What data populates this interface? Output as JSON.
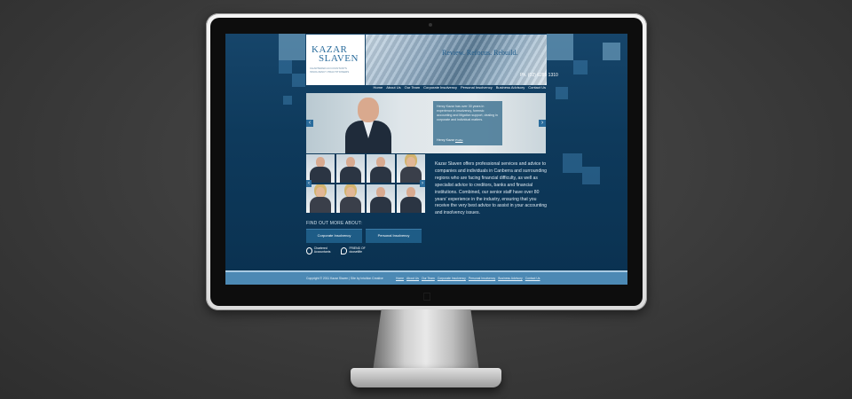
{
  "site": {
    "logo": {
      "line1": "KAZAR",
      "line2": "SLAVEN",
      "sub": "CHARTERED ACCOUNTANTS INSOLVENCY PRACTITIONERS"
    },
    "tagline": "Review. Refocus. Rebuild.",
    "phone": "Ph. (02) 6285 1310",
    "nav": [
      "Home",
      "About Us",
      "Our Team",
      "Corporate Insolvency",
      "Personal Insolvency",
      "Business Advisory",
      "Contact Us"
    ],
    "slider": {
      "quote": "Henry Kazar has over 30 years in experience in insolvency, forensic accounting and litigation support, dealing in corporate and individual matters.",
      "attribution": "Henry Kazar",
      "attribution_link": "Profile"
    },
    "body_text": "Kazar Slaven offers professional services and advice to companies and individuals in Canberra and surrounding regions who are facing financial difficulty, as well as specialist advice to creditors, banks and financial institutions. Combined, our senior staff have over 80 years' experience in the industry, ensuring that you receive the very best advice to assist in your accounting and insolvency issues.",
    "find_out_more": "FIND OUT MORE ABOUT:",
    "buttons": [
      "Corporate Insolvency",
      "Personal Insolvency"
    ],
    "badges": [
      {
        "text": "Chartered Accountants"
      },
      {
        "text": "FRIEND OF doosetlife"
      }
    ],
    "footer": {
      "copyright": "Copyright © 2011 Kazar Slaven | Site by Intuition Creative",
      "links": [
        "Home",
        "About Us",
        "Our Team",
        "Corporate Insolvency",
        "Personal Insolvency",
        "Business Advisory",
        "Contact Us"
      ]
    }
  },
  "colors": {
    "brand": "#2a6c9c",
    "screen_bg": "#0e3a5c",
    "footer": "#4c89b4"
  },
  "icons": {
    "apple_logo": "apple-icon",
    "prev": "chevron-left-icon",
    "next": "chevron-right-icon"
  }
}
